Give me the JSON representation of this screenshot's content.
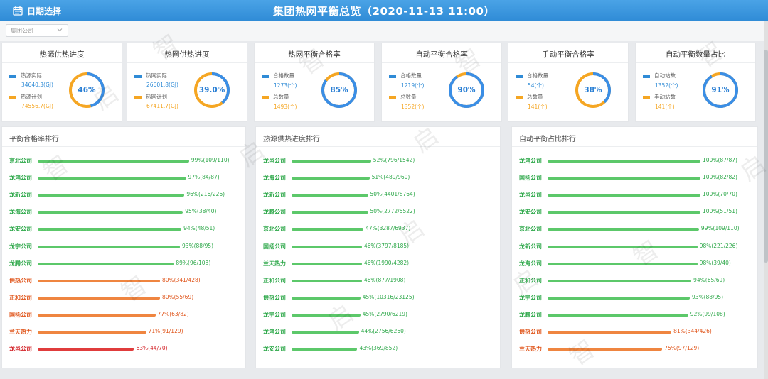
{
  "header": {
    "date_button_label": "日期选择",
    "title": "集团热网平衡总览（2020-11-13 11:00）",
    "date_icon": "calendar-icon"
  },
  "filter": {
    "company_placeholder": "集团公司"
  },
  "colors": {
    "primary": "#2f8bd6",
    "accent_orange": "#f5a623",
    "bar_green": "#5cc86a",
    "bar_orange": "#ef8540",
    "bar_red": "#e03c3c",
    "donut_blue": "#3a8ee6"
  },
  "kpis": [
    {
      "title": "热源供热进度",
      "legend1": "热源实际",
      "value1": "34640.3(GJ)",
      "legend2": "热源计划",
      "value2": "74556.7(GJ)",
      "percent_label": "46%",
      "percent": 46
    },
    {
      "title": "热网供热进度",
      "legend1": "热网实际",
      "value1": "26601.8(GJ)",
      "legend2": "热网计划",
      "value2": "67411.7(GJ)",
      "percent_label": "39.0%",
      "percent": 39
    },
    {
      "title": "热网平衡合格率",
      "legend1": "合格数量",
      "value1": "1273(个)",
      "legend2": "总数量",
      "value2": "1493(个)",
      "percent_label": "85%",
      "percent": 85
    },
    {
      "title": "自动平衡合格率",
      "legend1": "合格数量",
      "value1": "1219(个)",
      "legend2": "总数量",
      "value2": "1352(个)",
      "percent_label": "90%",
      "percent": 90
    },
    {
      "title": "手动平衡合格率",
      "legend1": "合格数量",
      "value1": "54(个)",
      "legend2": "总数量",
      "value2": "141(个)",
      "percent_label": "38%",
      "percent": 38
    },
    {
      "title": "自动平衡数量占比",
      "legend1": "自动站数",
      "value1": "1352(个)",
      "legend2": "手动站数",
      "value2": "141(个)",
      "percent_label": "91%",
      "percent": 91
    }
  ],
  "panels": [
    {
      "title": "平衡合格率排行",
      "rows": [
        {
          "name": "京北公司",
          "label": "99%(109/110)",
          "pct": 99,
          "level": "green"
        },
        {
          "name": "龙鸿公司",
          "label": "97%(84/87)",
          "pct": 97,
          "level": "green"
        },
        {
          "name": "龙新公司",
          "label": "96%(216/226)",
          "pct": 96,
          "level": "green"
        },
        {
          "name": "龙海公司",
          "label": "95%(38/40)",
          "pct": 95,
          "level": "green"
        },
        {
          "name": "龙安公司",
          "label": "94%(48/51)",
          "pct": 94,
          "level": "green"
        },
        {
          "name": "龙宇公司",
          "label": "93%(88/95)",
          "pct": 93,
          "level": "green"
        },
        {
          "name": "龙腾公司",
          "label": "89%(96/108)",
          "pct": 89,
          "level": "green"
        },
        {
          "name": "供热公司",
          "label": "80%(341/428)",
          "pct": 80,
          "level": "orange"
        },
        {
          "name": "正和公司",
          "label": "80%(55/69)",
          "pct": 80,
          "level": "orange"
        },
        {
          "name": "国扬公司",
          "label": "77%(63/82)",
          "pct": 77,
          "level": "orange"
        },
        {
          "name": "兰天热力",
          "label": "71%(91/129)",
          "pct": 71,
          "level": "orange"
        },
        {
          "name": "龙邑公司",
          "label": "63%(44/70)",
          "pct": 63,
          "level": "red"
        }
      ]
    },
    {
      "title": "热源供热进度排行",
      "rows": [
        {
          "name": "龙邑公司",
          "label": "52%(796/1542)",
          "pct": 52,
          "level": "green"
        },
        {
          "name": "龙海公司",
          "label": "51%(489/960)",
          "pct": 51,
          "level": "green"
        },
        {
          "name": "龙新公司",
          "label": "50%(4401/8764)",
          "pct": 50,
          "level": "green"
        },
        {
          "name": "龙腾公司",
          "label": "50%(2772/5522)",
          "pct": 50,
          "level": "green"
        },
        {
          "name": "京北公司",
          "label": "47%(3287/6937)",
          "pct": 47,
          "level": "green"
        },
        {
          "name": "国扬公司",
          "label": "46%(3797/8185)",
          "pct": 46,
          "level": "green"
        },
        {
          "name": "兰天热力",
          "label": "46%(1990/4282)",
          "pct": 46,
          "level": "green"
        },
        {
          "name": "正和公司",
          "label": "46%(877/1908)",
          "pct": 46,
          "level": "green"
        },
        {
          "name": "供热公司",
          "label": "45%(10316/23125)",
          "pct": 45,
          "level": "green"
        },
        {
          "name": "龙宇公司",
          "label": "45%(2790/6219)",
          "pct": 45,
          "level": "green"
        },
        {
          "name": "龙鸿公司",
          "label": "44%(2756/6260)",
          "pct": 44,
          "level": "green"
        },
        {
          "name": "龙安公司",
          "label": "43%(369/852)",
          "pct": 43,
          "level": "green"
        }
      ]
    },
    {
      "title": "自动平衡占比排行",
      "rows": [
        {
          "name": "龙鸿公司",
          "label": "100%(87/87)",
          "pct": 100,
          "level": "green"
        },
        {
          "name": "国扬公司",
          "label": "100%(82/82)",
          "pct": 100,
          "level": "green"
        },
        {
          "name": "龙邑公司",
          "label": "100%(70/70)",
          "pct": 100,
          "level": "green"
        },
        {
          "name": "龙安公司",
          "label": "100%(51/51)",
          "pct": 100,
          "level": "green"
        },
        {
          "name": "京北公司",
          "label": "99%(109/110)",
          "pct": 99,
          "level": "green"
        },
        {
          "name": "龙新公司",
          "label": "98%(221/226)",
          "pct": 98,
          "level": "green"
        },
        {
          "name": "龙海公司",
          "label": "98%(39/40)",
          "pct": 98,
          "level": "green"
        },
        {
          "name": "正和公司",
          "label": "94%(65/69)",
          "pct": 94,
          "level": "green"
        },
        {
          "name": "龙宇公司",
          "label": "93%(88/95)",
          "pct": 93,
          "level": "green"
        },
        {
          "name": "龙腾公司",
          "label": "92%(99/108)",
          "pct": 92,
          "level": "green"
        },
        {
          "name": "供热公司",
          "label": "81%(344/426)",
          "pct": 81,
          "level": "orange"
        },
        {
          "name": "兰天热力",
          "label": "75%(97/129)",
          "pct": 75,
          "level": "orange"
        }
      ]
    }
  ],
  "watermark": {
    "chars": [
      "启",
      "智"
    ]
  }
}
